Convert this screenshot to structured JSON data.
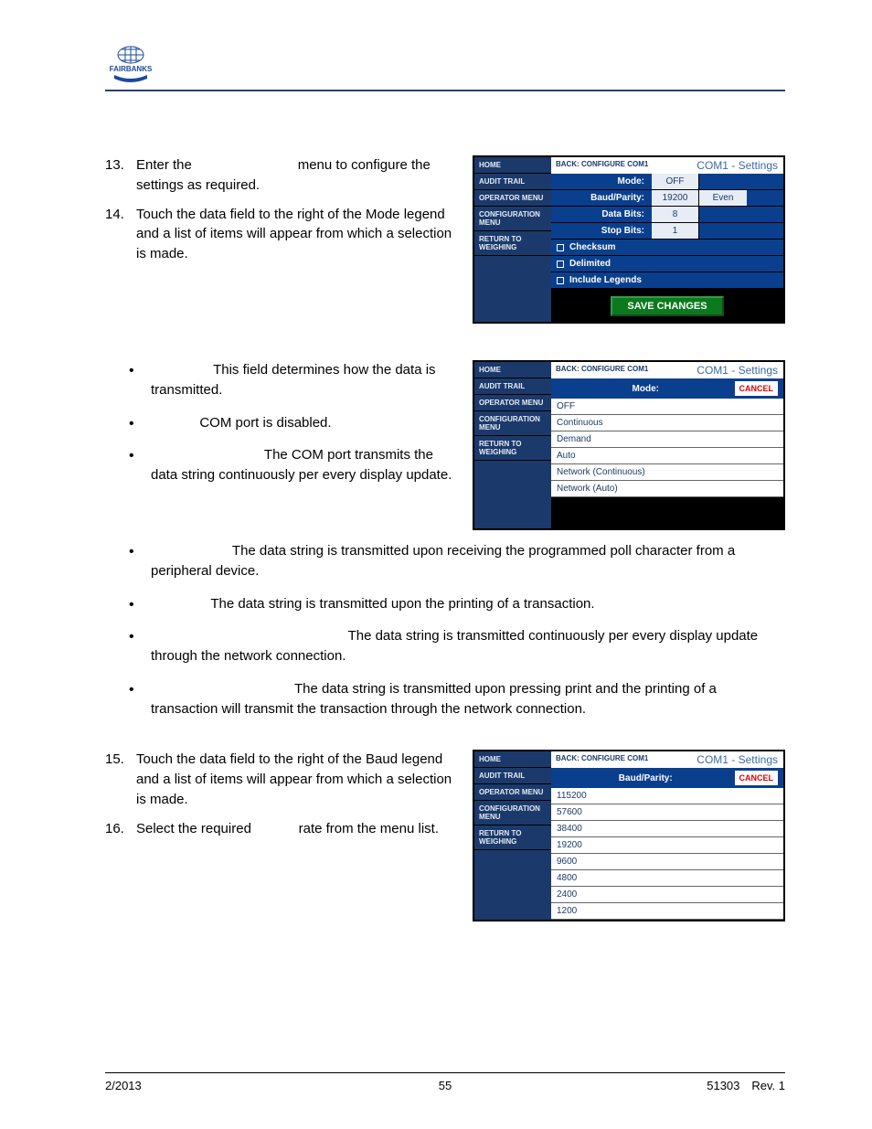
{
  "logo_text": "FAIRBANKS",
  "steps_a": [
    {
      "num": "13.",
      "text_a": "Enter the",
      "text_b": "menu to configure the settings as required."
    },
    {
      "num": "14.",
      "text_a": "Touch the data field to the right of the Mode legend and a list of items will appear from which a selection is made."
    }
  ],
  "bullets": [
    "This field determines how the data is transmitted.",
    "COM port is disabled.",
    "The COM port transmits the data string continuously per every display update.",
    "The data string is transmitted upon receiving the programmed poll character from a peripheral device.",
    "The data string is transmitted upon the printing of a transaction.",
    "The data string is transmitted continuously per every display update through the network connection.",
    "The data string is transmitted upon pressing print and the printing of a transaction will transmit the transaction through the network connection."
  ],
  "steps_b": [
    {
      "num": "15.",
      "text": "Touch the data field to the right of the Baud legend and a list of items will appear from which a selection is made."
    },
    {
      "num": "16.",
      "text_a": "Select the required",
      "text_b": "rate from the menu list."
    }
  ],
  "panel1": {
    "back": "BACK: CONFIGURE COM1",
    "title": "COM1 - Settings",
    "sidebar": [
      "HOME",
      "AUDIT TRAIL",
      "OPERATOR MENU",
      "CONFIGURATION MENU",
      "RETURN TO WEIGHING"
    ],
    "rows": [
      {
        "label": "Mode:",
        "v1": "OFF",
        "v2": ""
      },
      {
        "label": "Baud/Parity:",
        "v1": "19200",
        "v2": "Even"
      },
      {
        "label": "Data Bits:",
        "v1": "8",
        "v2": ""
      },
      {
        "label": "Stop Bits:",
        "v1": "1",
        "v2": ""
      }
    ],
    "checks": [
      "Checksum",
      "Delimited",
      "Include Legends"
    ],
    "save": "SAVE CHANGES"
  },
  "panel2": {
    "back": "BACK: CONFIGURE COM1",
    "title": "COM1 - Settings",
    "sidebar": [
      "HOME",
      "AUDIT TRAIL",
      "OPERATOR MENU",
      "CONFIGURATION MENU",
      "RETURN TO WEIGHING"
    ],
    "mode_label": "Mode:",
    "cancel": "CANCEL",
    "options": [
      "OFF",
      "Continuous",
      "Demand",
      "Auto",
      "Network (Continuous)",
      "Network (Auto)"
    ]
  },
  "panel3": {
    "back": "BACK: CONFIGURE COM1",
    "title": "COM1 - Settings",
    "sidebar": [
      "HOME",
      "AUDIT TRAIL",
      "OPERATOR MENU",
      "CONFIGURATION MENU",
      "RETURN TO WEIGHING"
    ],
    "mode_label": "Baud/Parity:",
    "cancel": "CANCEL",
    "options": [
      "115200",
      "57600",
      "38400",
      "19200",
      "9600",
      "4800",
      "2400",
      "1200"
    ]
  },
  "footer": {
    "left": "2/2013",
    "center": "55",
    "right": "51303 Rev. 1"
  }
}
